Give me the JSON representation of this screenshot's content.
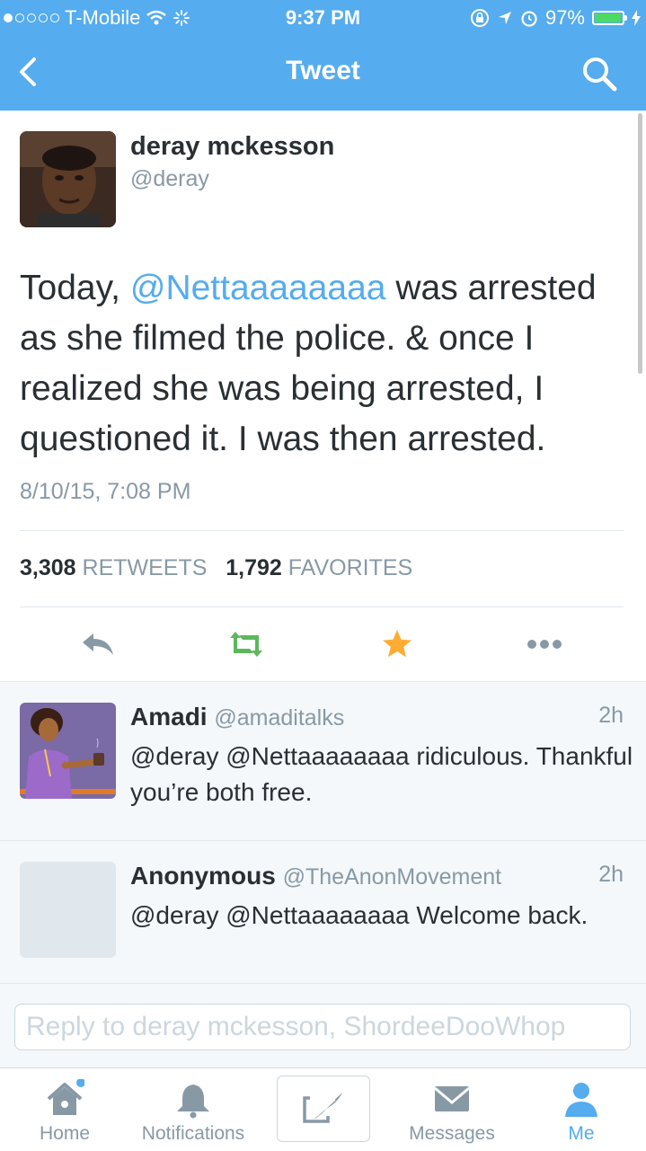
{
  "status_bar": {
    "carrier": "T-Mobile",
    "time": "9:37 PM",
    "battery": "97%",
    "battery_level": 0.97
  },
  "nav": {
    "title": "Tweet"
  },
  "tweet": {
    "author_name": "deray mckesson",
    "author_handle": "@deray",
    "text_before": "Today, ",
    "mention": "@Nettaaaaaaaa",
    "text_after": " was arrested as she filmed the police. & once I realized she was being arrested, I questioned it. I was then arrested.",
    "date": "8/10/15, 7:08 PM",
    "retweets_count": "3,308",
    "retweets_label": "RETWEETS",
    "favorites_count": "1,792",
    "favorites_label": "FAVORITES"
  },
  "replies": [
    {
      "name": "Amadi",
      "handle": "@amaditalks",
      "time": "2h",
      "text": "@deray @Nettaaaaaaaa ridiculous. Thankful you’re both free."
    },
    {
      "name": "Anonymous",
      "handle": "@TheAnonMovement",
      "time": "2h",
      "text": "@deray @Nettaaaaaaaa Welcome back."
    }
  ],
  "composer": {
    "placeholder": "Reply to deray mckesson, ShordeeDooWhop"
  },
  "tabs": [
    {
      "label": "Home",
      "icon": "home-icon"
    },
    {
      "label": "Notifications",
      "icon": "bell-icon"
    },
    {
      "label": "Messages",
      "icon": "envelope-icon"
    },
    {
      "label": "Me",
      "icon": "person-icon"
    }
  ],
  "colors": {
    "brand": "#55acee",
    "retweet": "#5cb85c",
    "favorite": "#ffac33",
    "text_secondary": "#8899a6"
  }
}
